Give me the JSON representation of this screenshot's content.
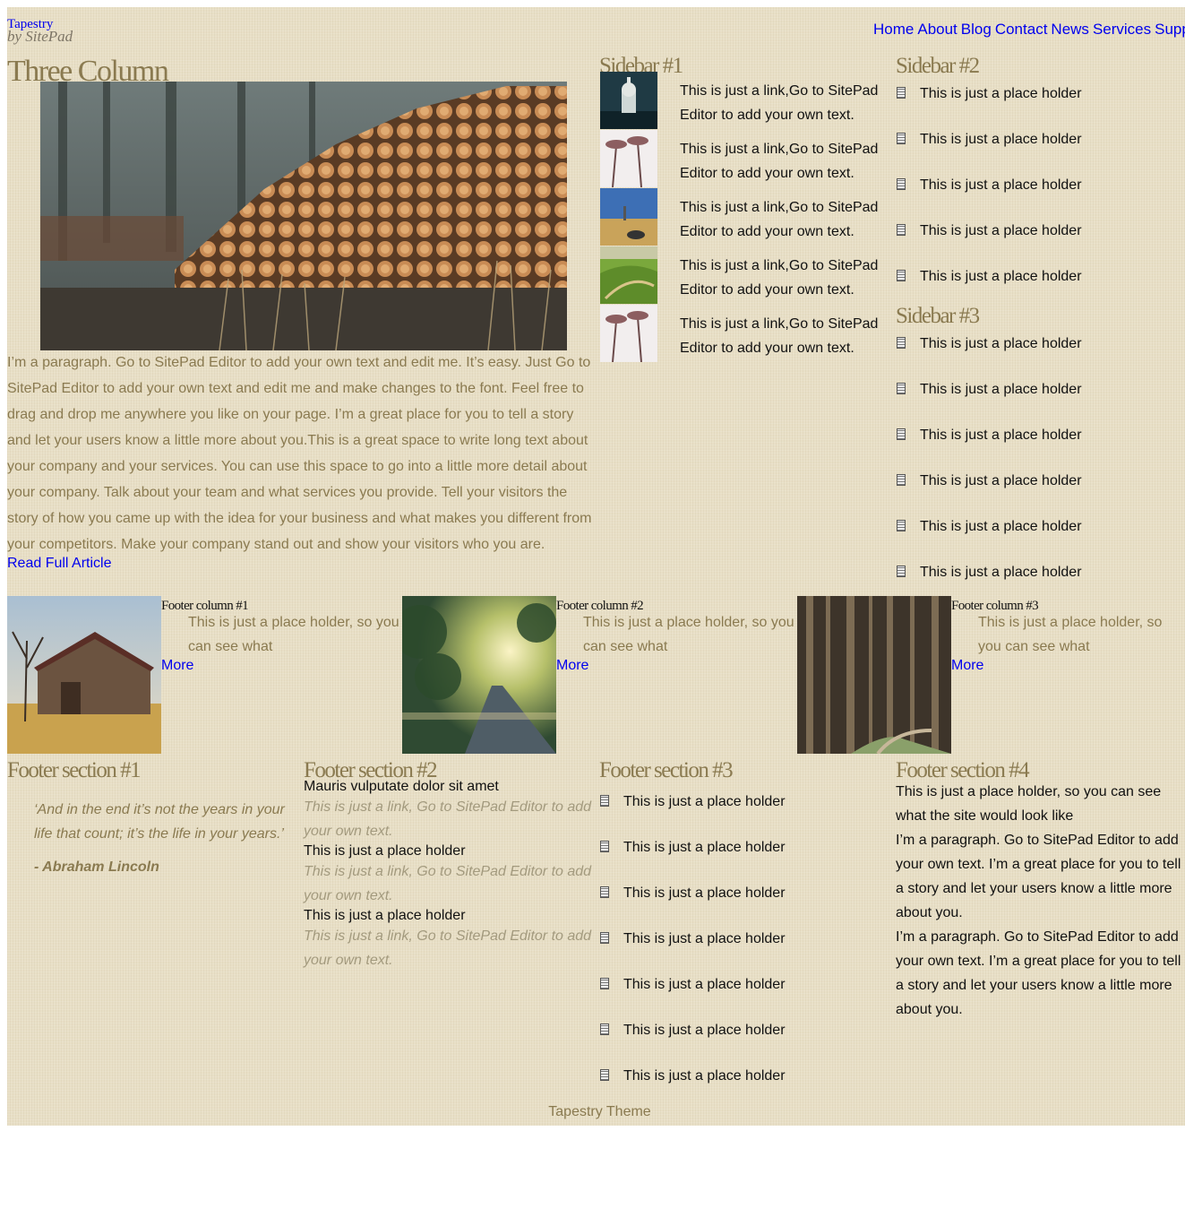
{
  "header": {
    "site_title": "Tapestry",
    "site_tagline": "by SitePad",
    "nav": [
      "Home",
      "About",
      "Blog",
      "Contact",
      "News",
      "Services",
      "Suppor"
    ]
  },
  "main": {
    "title": "Three Column",
    "paragraph": "I’m a paragraph. Go to SitePad Editor to add your own text and edit me. It’s easy. Just Go to SitePad Editor to add your own text and edit me and make changes to the font. Feel free to drag and drop me anywhere you like on your page. I’m a great place for you to tell a story and let your users know a little more about you.This is a great space to write long text about your company and your services. You can use this space to go into a little more detail about your company. Talk about your team and what services you provide. Tell your visitors the story of how you came up with the idea for your business and what makes you different from your competitors. Make your company stand out and show your visitors who you are.",
    "read_more": "Read Full Article"
  },
  "sidebar1": {
    "title": "Sidebar #1",
    "items": [
      {
        "text": "This is just a link,Go to SitePad Editor to add your own text.",
        "icon": "city-night-thumbnail"
      },
      {
        "text": "This is just a link,Go to SitePad Editor to add your own text.",
        "icon": "palm-trees-thumbnail"
      },
      {
        "text": "This is just a link,Go to SitePad Editor to add your own text.",
        "icon": "field-sky-thumbnail"
      },
      {
        "text": "This is just a link,Go to SitePad Editor to add your own text.",
        "icon": "green-hills-thumbnail"
      },
      {
        "text": "This is just a link,Go to SitePad Editor to add your own text.",
        "icon": "palm-trees-thumbnail"
      }
    ]
  },
  "sidebar2": {
    "title": "Sidebar #2",
    "items": [
      "This is just a place holder",
      "This is just a place holder",
      "This is just a place holder",
      "This is just a place holder",
      "This is just a place holder"
    ]
  },
  "sidebar3": {
    "title": "Sidebar #3",
    "items": [
      "This is just a place holder",
      "This is just a place holder",
      "This is just a place holder",
      "This is just a place holder",
      "This is just a place holder",
      "This is just a place holder"
    ]
  },
  "footer_columns": [
    {
      "title": "Footer column #1",
      "text": "This is just a place holder, so you can see what",
      "more": "More",
      "image": "barn-image"
    },
    {
      "title": "Footer column #2",
      "text": "This is just a place holder, so you can see what",
      "more": "More",
      "image": "sunlit-road-image"
    },
    {
      "title": "Footer column #3",
      "text": "This is just a place holder, so you can see what",
      "more": "More",
      "image": "forest-image"
    }
  ],
  "footer_sections": {
    "s1": {
      "title": "Footer section #1",
      "quote": "‘And in the end it’s not the years in your life that count; it’s the life in your years.’",
      "author": "- Abraham Lincoln"
    },
    "s2": {
      "title": "Footer section #2",
      "entries": [
        {
          "heading": "Mauris vulputate dolor sit amet",
          "link": "This is just a link, Go to SitePad Editor to add your own text."
        },
        {
          "heading": "This is just a place holder",
          "link": "This is just a link, Go to SitePad Editor to add your own text."
        },
        {
          "heading": "This is just a place holder",
          "link": "This is just a link, Go to SitePad Editor to add your own text."
        }
      ]
    },
    "s3": {
      "title": "Footer section #3",
      "items": [
        "This is just a place holder",
        "This is just a place holder",
        "This is just a place holder",
        "This is just a place holder",
        "This is just a place holder",
        "This is just a place holder",
        "This is just a place holder"
      ]
    },
    "s4": {
      "title": "Footer section #4",
      "lead": "This is just a place holder, so you can see what the site would look like",
      "paragraphs": [
        "I’m a paragraph. Go to SitePad Editor to add your own text. I’m a great place for you to tell a story and let your users know a little more about you.",
        "I’m a paragraph. Go to SitePad Editor to add your own text. I’m a great place for you to tell a story and let your users know a little more about you."
      ]
    }
  },
  "footer_text": "Tapestry Theme",
  "hero_image": "log-pile-image",
  "colors": {
    "background": "#e8dfc6",
    "heading": "#8a7a50",
    "link": "#0000ee"
  }
}
